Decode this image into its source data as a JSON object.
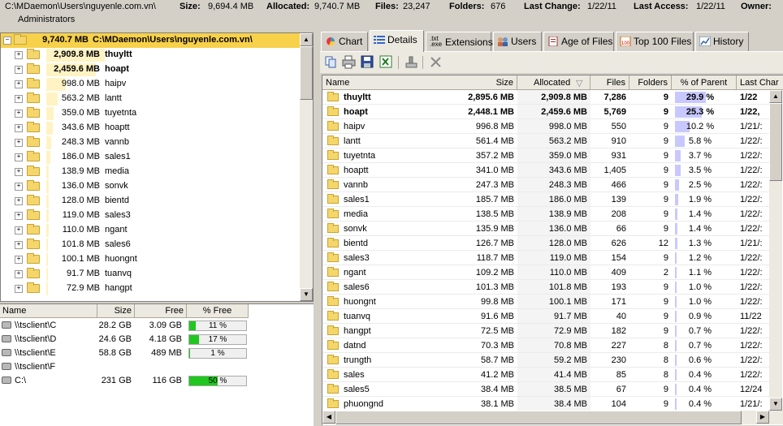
{
  "header": {
    "path": "C:\\MDaemon\\Users\\nguyenle.com.vn\\",
    "size_label": "Size:",
    "size_value": "9,694.4 MB",
    "allocated_label": "Allocated:",
    "allocated_value": "9,740.7 MB",
    "files_label": "Files:",
    "files_value": "23,247",
    "folders_label": "Folders:",
    "folders_value": "676",
    "lastchange_label": "Last Change:",
    "lastchange_value": "1/22/11",
    "lastaccess_label": "Last Access:",
    "lastaccess_value": "1/22/11",
    "owner_label": "Owner:",
    "owner_value": "Administrators"
  },
  "tree": {
    "root": {
      "size": "9,740.7 MB",
      "name": "C:\\MDaemon\\Users\\nguyenle.com.vn\\"
    },
    "items": [
      {
        "size": "2,909.8 MB",
        "name": "thuyltt",
        "pct": 29.9
      },
      {
        "size": "2,459.6 MB",
        "name": "hoapt",
        "pct": 25.3
      },
      {
        "size": "998.0 MB",
        "name": "haipv",
        "pct": 10.2
      },
      {
        "size": "563.2 MB",
        "name": "lantt",
        "pct": 5.8
      },
      {
        "size": "359.0 MB",
        "name": "tuyetnta",
        "pct": 3.7
      },
      {
        "size": "343.6 MB",
        "name": "hoaptt",
        "pct": 3.5
      },
      {
        "size": "248.3 MB",
        "name": "vannb",
        "pct": 2.5
      },
      {
        "size": "186.0 MB",
        "name": "sales1",
        "pct": 1.9
      },
      {
        "size": "138.9 MB",
        "name": "media",
        "pct": 1.4
      },
      {
        "size": "136.0 MB",
        "name": "sonvk",
        "pct": 1.4
      },
      {
        "size": "128.0 MB",
        "name": "bientd",
        "pct": 1.3
      },
      {
        "size": "119.0 MB",
        "name": "sales3",
        "pct": 1.2
      },
      {
        "size": "110.0 MB",
        "name": "ngant",
        "pct": 1.1
      },
      {
        "size": "101.8 MB",
        "name": "sales6",
        "pct": 1.0
      },
      {
        "size": "100.1 MB",
        "name": "huongnt",
        "pct": 1.0
      },
      {
        "size": "91.7 MB",
        "name": "tuanvq",
        "pct": 0.9
      },
      {
        "size": "72.9 MB",
        "name": "hangpt",
        "pct": 0.7
      }
    ]
  },
  "drives": {
    "columns": [
      "Name",
      "Size",
      "Free",
      "% Free"
    ],
    "rows": [
      {
        "name": "\\\\tsclient\\C",
        "size": "28.2 GB",
        "free": "3.09 GB",
        "pct_label": "11 %",
        "pct": 11
      },
      {
        "name": "\\\\tsclient\\D",
        "size": "24.6 GB",
        "free": "4.18 GB",
        "pct_label": "17 %",
        "pct": 17
      },
      {
        "name": "\\\\tsclient\\E",
        "size": "58.8 GB",
        "free": "489 MB",
        "pct_label": "1 %",
        "pct": 1
      },
      {
        "name": "\\\\tsclient\\F",
        "size": "",
        "free": "",
        "pct_label": "",
        "pct": null
      },
      {
        "name": "C:\\",
        "size": "231 GB",
        "free": "116 GB",
        "pct_label": "50 %",
        "pct": 50
      }
    ]
  },
  "tabs": [
    {
      "label": "Chart",
      "icon": "chart-icon"
    },
    {
      "label": "Details",
      "icon": "details-icon",
      "active": true
    },
    {
      "label": "Extensions",
      "icon": "extensions-icon"
    },
    {
      "label": "Users",
      "icon": "users-icon"
    },
    {
      "label": "Age of Files",
      "icon": "age-of-files-icon"
    },
    {
      "label": "Top 100 Files",
      "icon": "top-100-files-icon"
    },
    {
      "label": "History",
      "icon": "history-icon"
    }
  ],
  "tab_ext_icon_text": {
    "line1": ".txt",
    "line2": ".exe"
  },
  "toolbar": [
    "copy-icon",
    "print-icon",
    "save-icon",
    "excel-export-icon",
    "explorer-icon",
    "delete-icon"
  ],
  "details": {
    "columns": [
      "Name",
      "Size",
      "Allocated",
      "Files",
      "Folders",
      "% of Parent",
      "Last Char"
    ],
    "sort_indicator": "▽",
    "rows": [
      {
        "name": "thuyltt",
        "size": "2,895.6 MB",
        "allocated": "2,909.8 MB",
        "files": "7,286",
        "folders": "9",
        "pct": 29.9,
        "pct_label": "29.9 %",
        "last": "1/22",
        "bold": true
      },
      {
        "name": "hoapt",
        "size": "2,448.1 MB",
        "allocated": "2,459.6 MB",
        "files": "5,769",
        "folders": "9",
        "pct": 25.3,
        "pct_label": "25.3 %",
        "last": "1/22,",
        "bold": true
      },
      {
        "name": "haipv",
        "size": "996.8 MB",
        "allocated": "998.0 MB",
        "files": "550",
        "folders": "9",
        "pct": 10.2,
        "pct_label": "10.2 %",
        "last": "1/21/:"
      },
      {
        "name": "lantt",
        "size": "561.4 MB",
        "allocated": "563.2 MB",
        "files": "910",
        "folders": "9",
        "pct": 5.8,
        "pct_label": "5.8 %",
        "last": "1/22/:"
      },
      {
        "name": "tuyetnta",
        "size": "357.2 MB",
        "allocated": "359.0 MB",
        "files": "931",
        "folders": "9",
        "pct": 3.7,
        "pct_label": "3.7 %",
        "last": "1/22/:"
      },
      {
        "name": "hoaptt",
        "size": "341.0 MB",
        "allocated": "343.6 MB",
        "files": "1,405",
        "folders": "9",
        "pct": 3.5,
        "pct_label": "3.5 %",
        "last": "1/22/:"
      },
      {
        "name": "vannb",
        "size": "247.3 MB",
        "allocated": "248.3 MB",
        "files": "466",
        "folders": "9",
        "pct": 2.5,
        "pct_label": "2.5 %",
        "last": "1/22/:"
      },
      {
        "name": "sales1",
        "size": "185.7 MB",
        "allocated": "186.0 MB",
        "files": "139",
        "folders": "9",
        "pct": 1.9,
        "pct_label": "1.9 %",
        "last": "1/22/:"
      },
      {
        "name": "media",
        "size": "138.5 MB",
        "allocated": "138.9 MB",
        "files": "208",
        "folders": "9",
        "pct": 1.4,
        "pct_label": "1.4 %",
        "last": "1/22/:"
      },
      {
        "name": "sonvk",
        "size": "135.9 MB",
        "allocated": "136.0 MB",
        "files": "66",
        "folders": "9",
        "pct": 1.4,
        "pct_label": "1.4 %",
        "last": "1/22/:"
      },
      {
        "name": "bientd",
        "size": "126.7 MB",
        "allocated": "128.0 MB",
        "files": "626",
        "folders": "12",
        "pct": 1.3,
        "pct_label": "1.3 %",
        "last": "1/21/:"
      },
      {
        "name": "sales3",
        "size": "118.7 MB",
        "allocated": "119.0 MB",
        "files": "154",
        "folders": "9",
        "pct": 1.2,
        "pct_label": "1.2 %",
        "last": "1/22/:"
      },
      {
        "name": "ngant",
        "size": "109.2 MB",
        "allocated": "110.0 MB",
        "files": "409",
        "folders": "2",
        "pct": 1.1,
        "pct_label": "1.1 %",
        "last": "1/22/:"
      },
      {
        "name": "sales6",
        "size": "101.3 MB",
        "allocated": "101.8 MB",
        "files": "193",
        "folders": "9",
        "pct": 1.0,
        "pct_label": "1.0 %",
        "last": "1/22/:"
      },
      {
        "name": "huongnt",
        "size": "99.8 MB",
        "allocated": "100.1 MB",
        "files": "171",
        "folders": "9",
        "pct": 1.0,
        "pct_label": "1.0 %",
        "last": "1/22/:"
      },
      {
        "name": "tuanvq",
        "size": "91.6 MB",
        "allocated": "91.7 MB",
        "files": "40",
        "folders": "9",
        "pct": 0.9,
        "pct_label": "0.9 %",
        "last": "11/22"
      },
      {
        "name": "hangpt",
        "size": "72.5 MB",
        "allocated": "72.9 MB",
        "files": "182",
        "folders": "9",
        "pct": 0.7,
        "pct_label": "0.7 %",
        "last": "1/22/:"
      },
      {
        "name": "datnd",
        "size": "70.3 MB",
        "allocated": "70.8 MB",
        "files": "227",
        "folders": "8",
        "pct": 0.7,
        "pct_label": "0.7 %",
        "last": "1/22/:"
      },
      {
        "name": "trungth",
        "size": "58.7 MB",
        "allocated": "59.2 MB",
        "files": "230",
        "folders": "8",
        "pct": 0.6,
        "pct_label": "0.6 %",
        "last": "1/22/:"
      },
      {
        "name": "sales",
        "size": "41.2 MB",
        "allocated": "41.4 MB",
        "files": "85",
        "folders": "8",
        "pct": 0.4,
        "pct_label": "0.4 %",
        "last": "1/22/:"
      },
      {
        "name": "sales5",
        "size": "38.4 MB",
        "allocated": "38.5 MB",
        "files": "67",
        "folders": "9",
        "pct": 0.4,
        "pct_label": "0.4 %",
        "last": "12/24"
      },
      {
        "name": "phuongnd",
        "size": "38.1 MB",
        "allocated": "38.4 MB",
        "files": "104",
        "folders": "9",
        "pct": 0.4,
        "pct_label": "0.4 %",
        "last": "1/21/:"
      }
    ]
  }
}
